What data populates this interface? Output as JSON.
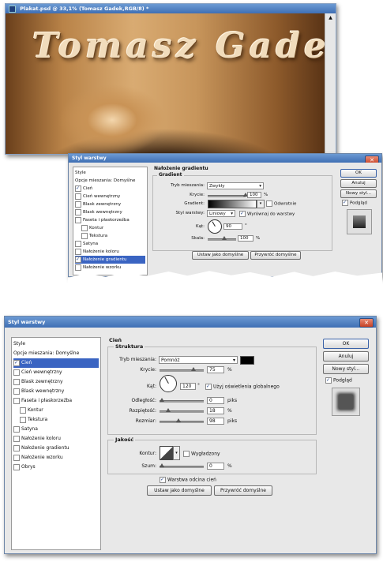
{
  "photo_window": {
    "title": "Plakat.psd @ 33,1% (Tomasz Gadek,RGB/8) *",
    "artwork_text": "Tomasz Gadek"
  },
  "dialog_top": {
    "title": "Styl warstwy",
    "style_list": [
      {
        "label": "Style",
        "checkbox": false
      },
      {
        "label": "Opcje mieszania: Domyślne",
        "checkbox": false
      },
      {
        "label": "Cień",
        "checkbox": true,
        "checked": true
      },
      {
        "label": "Cień wewnętrzny",
        "checkbox": true
      },
      {
        "label": "Blask zewnętrzny",
        "checkbox": true
      },
      {
        "label": "Blask wewnętrzny",
        "checkbox": true
      },
      {
        "label": "Faseta i płaskorzeźba",
        "checkbox": true
      },
      {
        "label": "Kontur",
        "checkbox": true,
        "indent": true
      },
      {
        "label": "Tekstura",
        "checkbox": true,
        "indent": true
      },
      {
        "label": "Satyna",
        "checkbox": true
      },
      {
        "label": "Nałożenie koloru",
        "checkbox": true
      },
      {
        "label": "Nałożenie gradientu",
        "checkbox": true,
        "checked": true,
        "selected": true
      },
      {
        "label": "Nałożenie wzorku",
        "checkbox": true
      }
    ],
    "section_title": "Nałożenie gradientu",
    "group_title": "Gradient",
    "blend_mode_label": "Tryb mieszania:",
    "blend_mode_value": "Zwykły",
    "opacity_label": "Krycie:",
    "opacity_value": "100",
    "gradient_label": "Gradient:",
    "reverse_label": "Odwrotnie",
    "style_label": "Styl warstwy:",
    "style_value": "Liniowy",
    "align_label": "Wyrównaj do warstwy",
    "angle_label": "Kąt:",
    "angle_value": "90",
    "scale_label": "Skala:",
    "scale_value": "100",
    "percent": "%",
    "degree": "°",
    "make_default": "Ustaw jako domyślne",
    "reset_default": "Przywróć domyślne",
    "ok": "OK",
    "cancel": "Anuluj",
    "new_style": "Nowy styl...",
    "preview": "Podgląd"
  },
  "dialog_bottom": {
    "title": "Styl warstwy",
    "style_list": [
      {
        "label": "Style",
        "checkbox": false
      },
      {
        "label": "Opcje mieszania: Domyślne",
        "checkbox": false
      },
      {
        "label": "Cień",
        "checkbox": true,
        "checked": true,
        "selected": true
      },
      {
        "label": "Cień wewnętrzny",
        "checkbox": true
      },
      {
        "label": "Blask zewnętrzny",
        "checkbox": true
      },
      {
        "label": "Blask wewnętrzny",
        "checkbox": true
      },
      {
        "label": "Faseta i płaskorzeźba",
        "checkbox": true
      },
      {
        "label": "Kontur",
        "checkbox": true,
        "indent": true
      },
      {
        "label": "Tekstura",
        "checkbox": true,
        "indent": true
      },
      {
        "label": "Satyna",
        "checkbox": true
      },
      {
        "label": "Nałożenie koloru",
        "checkbox": true
      },
      {
        "label": "Nałożenie gradientu",
        "checkbox": true
      },
      {
        "label": "Nałożenie wzorku",
        "checkbox": true
      },
      {
        "label": "Obrys",
        "checkbox": true
      }
    ],
    "section_title": "Cień",
    "structure_title": "Struktura",
    "blend_mode_label": "Tryb mieszania:",
    "blend_mode_value": "Pomnóż",
    "opacity_label": "Krycie:",
    "opacity_value": "75",
    "angle_label": "Kąt:",
    "angle_value": "120",
    "global_light_label": "Użyj oświetlenia globalnego",
    "distance_label": "Odległość:",
    "distance_value": "0",
    "spread_label": "Rozpiętość:",
    "spread_value": "18",
    "size_label": "Rozmiar:",
    "size_value": "98",
    "px": "piks",
    "percent": "%",
    "degree": "°",
    "quality_title": "Jakość",
    "contour_label": "Kontur:",
    "antialias_label": "Wygładzony",
    "noise_label": "Szum:",
    "noise_value": "0",
    "knockout_label": "Warstwa odcina cień",
    "make_default": "Ustaw jako domyślne",
    "reset_default": "Przywróć domyślne",
    "ok": "OK",
    "cancel": "Anuluj",
    "new_style": "Nowy styl...",
    "preview": "Podgląd"
  },
  "colors": {
    "titlebar": "#3f6fb4",
    "selection": "#3a64c2",
    "sepia_dark": "#3b2410",
    "sepia_light": "#e0b27a"
  }
}
